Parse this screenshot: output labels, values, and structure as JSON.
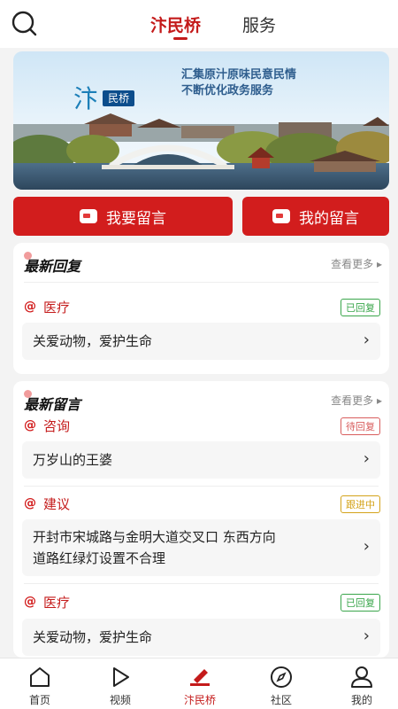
{
  "header": {
    "search_icon": "search-icon",
    "tabs": [
      {
        "label": "汴民桥",
        "active": true
      },
      {
        "label": "服务",
        "active": false
      }
    ]
  },
  "banner": {
    "logo_text": "民桥",
    "slogan_line1": "汇集原汁原味民意民情",
    "slogan_line2": "不断优化政务服务"
  },
  "actions": {
    "leave_message": "我要留言",
    "my_messages": "我的留言"
  },
  "latest_replies": {
    "title": "最新回复",
    "more": "查看更多",
    "items": [
      {
        "category": "医疗",
        "status": "已回复",
        "text": "关爱动物，爱护生命"
      }
    ]
  },
  "latest_messages": {
    "title": "最新留言",
    "more": "查看更多",
    "items": [
      {
        "category": "咨询",
        "status": "待回复",
        "text": "万岁山的王婆"
      },
      {
        "category": "建议",
        "status": "跟进中",
        "text_line1": "开封市宋城路与金明大道交叉口 东西方向",
        "text_line2": "道路红绿灯设置不合理"
      },
      {
        "category": "医疗",
        "status": "已回复",
        "text": "关爱动物，爱护生命"
      }
    ]
  },
  "bottom_nav": [
    {
      "label": "首页",
      "icon": "home-icon"
    },
    {
      "label": "视频",
      "icon": "play-icon"
    },
    {
      "label": "汴民桥",
      "icon": "bridge-icon",
      "active": true
    },
    {
      "label": "社区",
      "icon": "compass-icon"
    },
    {
      "label": "我的",
      "icon": "user-icon"
    }
  ],
  "colors": {
    "accent": "#c41b1b",
    "button": "#d21d1d",
    "replied": "#3aa64b",
    "pending": "#d85d5d",
    "following": "#d4a31a"
  }
}
